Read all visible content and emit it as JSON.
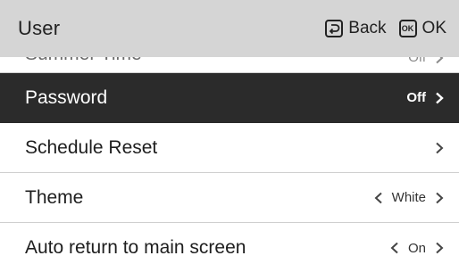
{
  "header": {
    "title": "User",
    "back_label": "Back",
    "ok_label": "OK",
    "back_icon": "return-arrow-icon",
    "ok_icon": "ok-key-icon",
    "ok_icon_text": "OK"
  },
  "menu": {
    "items": [
      {
        "label": "Summer Time",
        "value": "Off",
        "icon": "chevron-right-icon"
      },
      {
        "label": "Password",
        "value": "Off",
        "icon": "chevron-right-icon",
        "selected": true
      },
      {
        "label": "Schedule Reset",
        "value": "",
        "icon": "chevron-right-icon"
      },
      {
        "label": "Theme",
        "value": "White",
        "icon": "chevron-left-right-icon"
      },
      {
        "label": "Auto return to main screen",
        "value": "On",
        "icon": "chevron-left-right-icon"
      }
    ]
  },
  "colors": {
    "header_bg": "#d5d5d5",
    "selected_bg": "#2b2b2b",
    "selected_text": "#ffffff",
    "text": "#1e1e1e",
    "divider": "#cfcfcf"
  }
}
